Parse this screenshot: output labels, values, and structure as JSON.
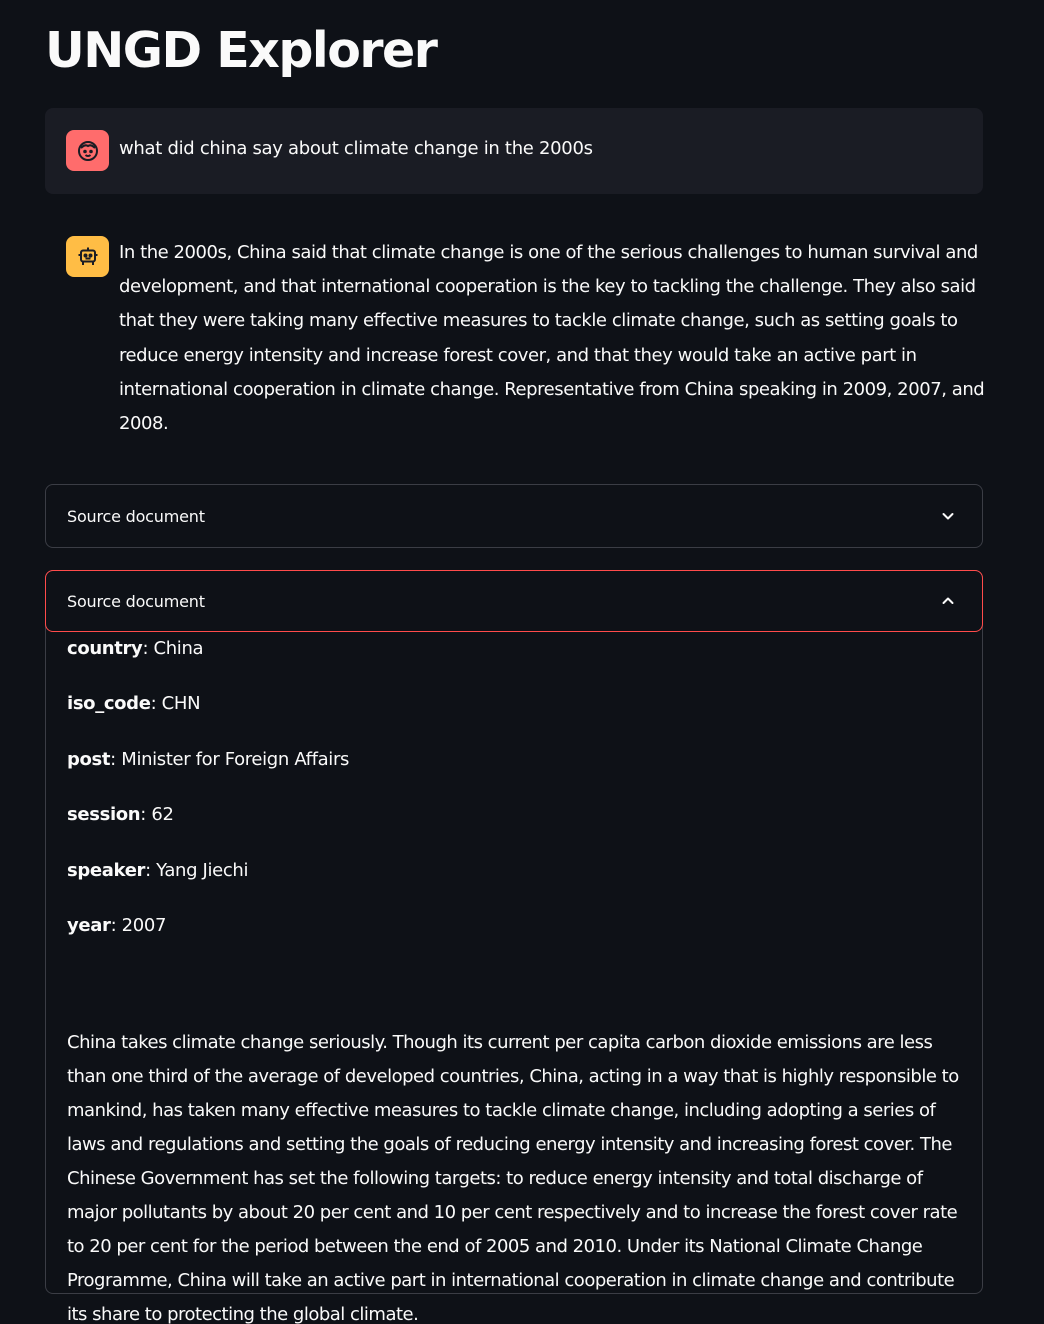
{
  "app": {
    "title": "UNGD Explorer"
  },
  "chat": {
    "user_message": "what did china say about climate change in the 2000s",
    "assistant_message": "In the 2000s, China said that climate change is one of the serious challenges to human survival and development, and that international cooperation is the key to tackling the challenge. They also said that they were taking many effective measures to tackle climate change, such as setting goals to reduce energy intensity and increase forest cover, and that they would take an active part in international cooperation in climate change. Representative from China speaking in 2009, 2007, and 2008."
  },
  "expanders": [
    {
      "label": "Source document",
      "expanded": false,
      "icon": "chevron-down-icon"
    },
    {
      "label": "Source document",
      "expanded": true,
      "icon": "chevron-up-icon",
      "fields": [
        {
          "key": "country",
          "value": ": China"
        },
        {
          "key": "iso_code",
          "value": ": CHN"
        },
        {
          "key": "post",
          "value": ": Minister for Foreign Affairs"
        },
        {
          "key": "session",
          "value": ": 62"
        },
        {
          "key": "speaker",
          "value": ": Yang Jiechi"
        },
        {
          "key": "year",
          "value": ": 2007"
        }
      ],
      "text": "China takes climate change seriously. Though its current per capita carbon dioxide emissions are less than one third of the average of developed countries, China, acting in a way that is highly responsible to mankind, has taken many effective measures to tackle climate change, including adopting a series of laws and regulations and setting the goals of reducing energy intensity and increasing forest cover. The Chinese Government has set the following targets: to reduce energy intensity and total discharge of major pollutants by about 20 per cent and 10 per cent respectively and to increase the forest cover rate to 20 per cent for the period between the end of 2005 and 2010. Under its National Climate Change Programme, China will take an active part in international cooperation in climate change and contribute its share to protecting the global climate."
    }
  ],
  "colors": {
    "background": "#0e1117",
    "user_bubble": "#1a1c24",
    "user_avatar": "#ff6c6c",
    "assistant_avatar": "#ffbd45",
    "expander_border": "#3b3d45",
    "expander_focus": "#ff4b4b"
  }
}
